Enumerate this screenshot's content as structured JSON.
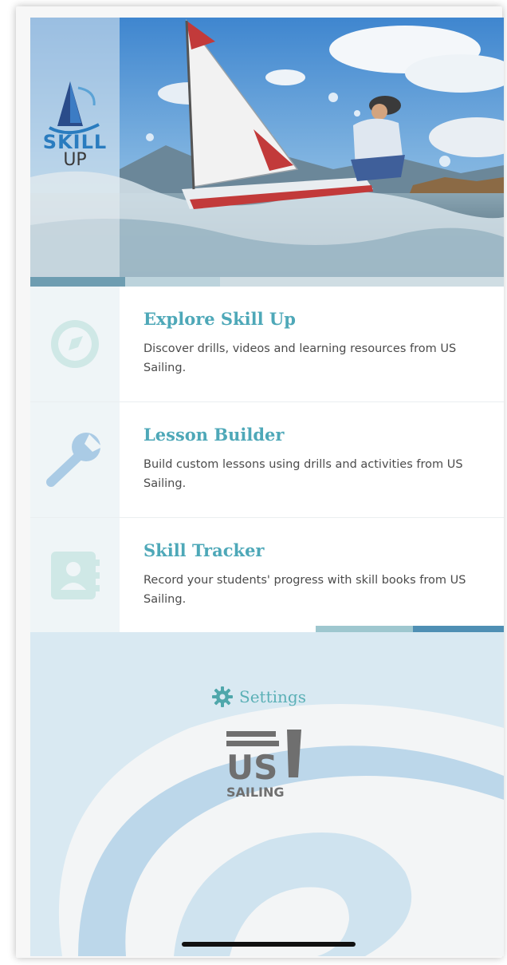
{
  "logo": {
    "line1": "SKILL",
    "line2": "UP"
  },
  "hero": {
    "progress": 0.4
  },
  "menu": {
    "items": [
      {
        "title": "Explore Skill Up",
        "description": "Discover drills, videos and learning resources from US Sailing.",
        "icon": "compass-icon"
      },
      {
        "title": "Lesson Builder",
        "description": "Build custom lessons using drills and activities from US Sailing.",
        "icon": "wrench-icon"
      },
      {
        "title": "Skill Tracker",
        "description": "Record your students' progress with skill books from US Sailing.",
        "icon": "contact-book-icon"
      }
    ]
  },
  "settings": {
    "label": "Settings",
    "icon": "gear-icon"
  },
  "brand": {
    "line1": "US",
    "line2": "SAILING"
  },
  "colors": {
    "accent_teal": "#4ea8b8",
    "brand_blue": "#2a7cbf",
    "description_text": "#4b4b4b",
    "wave_light": "#d9e9f2",
    "wave_mid": "#bcd7ea"
  }
}
